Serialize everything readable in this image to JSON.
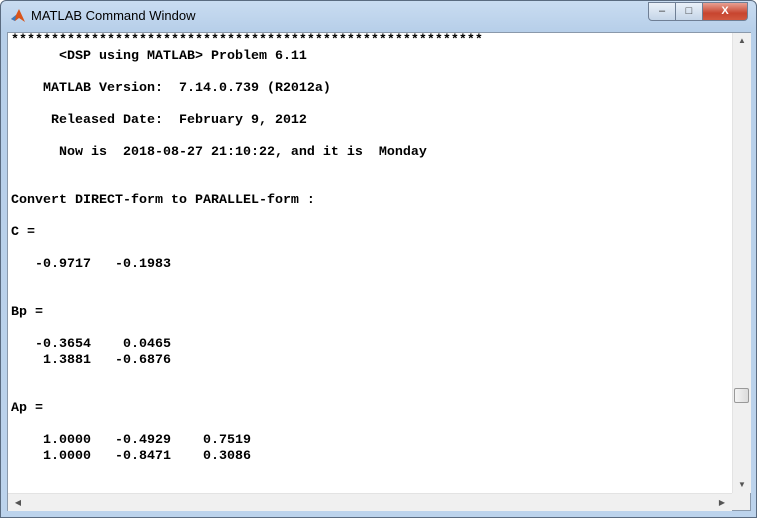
{
  "window": {
    "title": "MATLAB Command Window",
    "icon": "matlab-logo-icon",
    "buttons": {
      "minimize": "–",
      "maximize": "□",
      "close": "X"
    }
  },
  "console": {
    "lines": [
      "***********************************************************",
      "      <DSP using MATLAB> Problem 6.11",
      "",
      "    MATLAB Version:  7.14.0.739 (R2012a)",
      "",
      "     Released Date:  February 9, 2012",
      "",
      "      Now is  2018-08-27 21:10:22, and it is  Monday",
      "",
      "",
      "Convert DIRECT-form to PARALLEL-form :",
      "",
      "C =",
      "",
      "   -0.9717   -0.1983",
      "",
      "",
      "Bp =",
      "",
      "   -0.3654    0.0465",
      "    1.3881   -0.6876",
      "",
      "",
      "Ap =",
      "",
      "    1.0000   -0.4929    0.7519",
      "    1.0000   -0.8471    0.3086"
    ]
  },
  "scrollbars": {
    "vertical_position_percent": 82,
    "up": "▲",
    "down": "▼",
    "left": "◀",
    "right": "▶"
  }
}
